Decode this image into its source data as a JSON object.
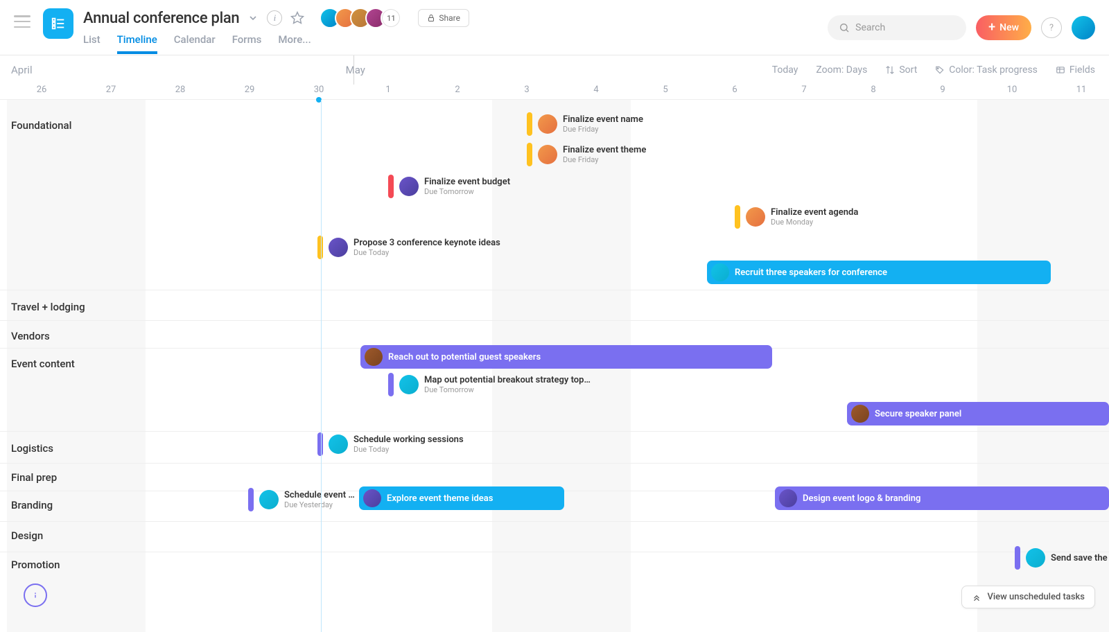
{
  "header": {
    "project_title": "Annual conference plan",
    "member_overflow": "11",
    "share_label": "Share",
    "search_placeholder": "Search",
    "new_label": "New",
    "tabs": {
      "list": "List",
      "timeline": "Timeline",
      "calendar": "Calendar",
      "forms": "Forms",
      "more": "More..."
    }
  },
  "controls": {
    "month_left": "April",
    "month_right": "May",
    "today": "Today",
    "zoom": "Zoom: Days",
    "sort": "Sort",
    "color": "Color: Task progress",
    "fields": "Fields"
  },
  "days": [
    "26",
    "27",
    "28",
    "29",
    "30",
    "1",
    "2",
    "3",
    "4",
    "5",
    "6",
    "7",
    "8",
    "9",
    "10",
    "11"
  ],
  "sections": {
    "foundational": "Foundational",
    "travel": "Travel + lodging",
    "vendors": "Vendors",
    "event_content": "Event content",
    "logistics": "Logistics",
    "final_prep": "Final prep",
    "branding": "Branding",
    "design": "Design",
    "promotion": "Promotion"
  },
  "tasks": {
    "ev_name": {
      "title": "Finalize event name",
      "due": "Due Friday"
    },
    "ev_theme": {
      "title": "Finalize event theme",
      "due": "Due Friday"
    },
    "ev_budget": {
      "title": "Finalize event budget",
      "due": "Due Tomorrow"
    },
    "ev_agenda": {
      "title": "Finalize event agenda",
      "due": "Due Monday"
    },
    "keynote": {
      "title": "Propose 3 conference keynote ideas",
      "due": "Due Today"
    },
    "recruit": {
      "title": "Recruit three speakers for conference"
    },
    "reach": {
      "title": "Reach out to potential guest speakers"
    },
    "mapout": {
      "title": "Map out potential breakout strategy top…",
      "due": "Due Tomorrow"
    },
    "secure": {
      "title": "Secure speaker panel"
    },
    "schedule": {
      "title": "Schedule working sessions",
      "due": "Due Today"
    },
    "sched_ev": {
      "title": "Schedule event …",
      "due": "Due Yesterday"
    },
    "explore": {
      "title": "Explore event theme ideas"
    },
    "designlogo": {
      "title": "Design event logo & branding"
    },
    "savedate": {
      "title": "Send save the da"
    }
  },
  "footer": {
    "unscheduled": "View unscheduled tasks"
  }
}
